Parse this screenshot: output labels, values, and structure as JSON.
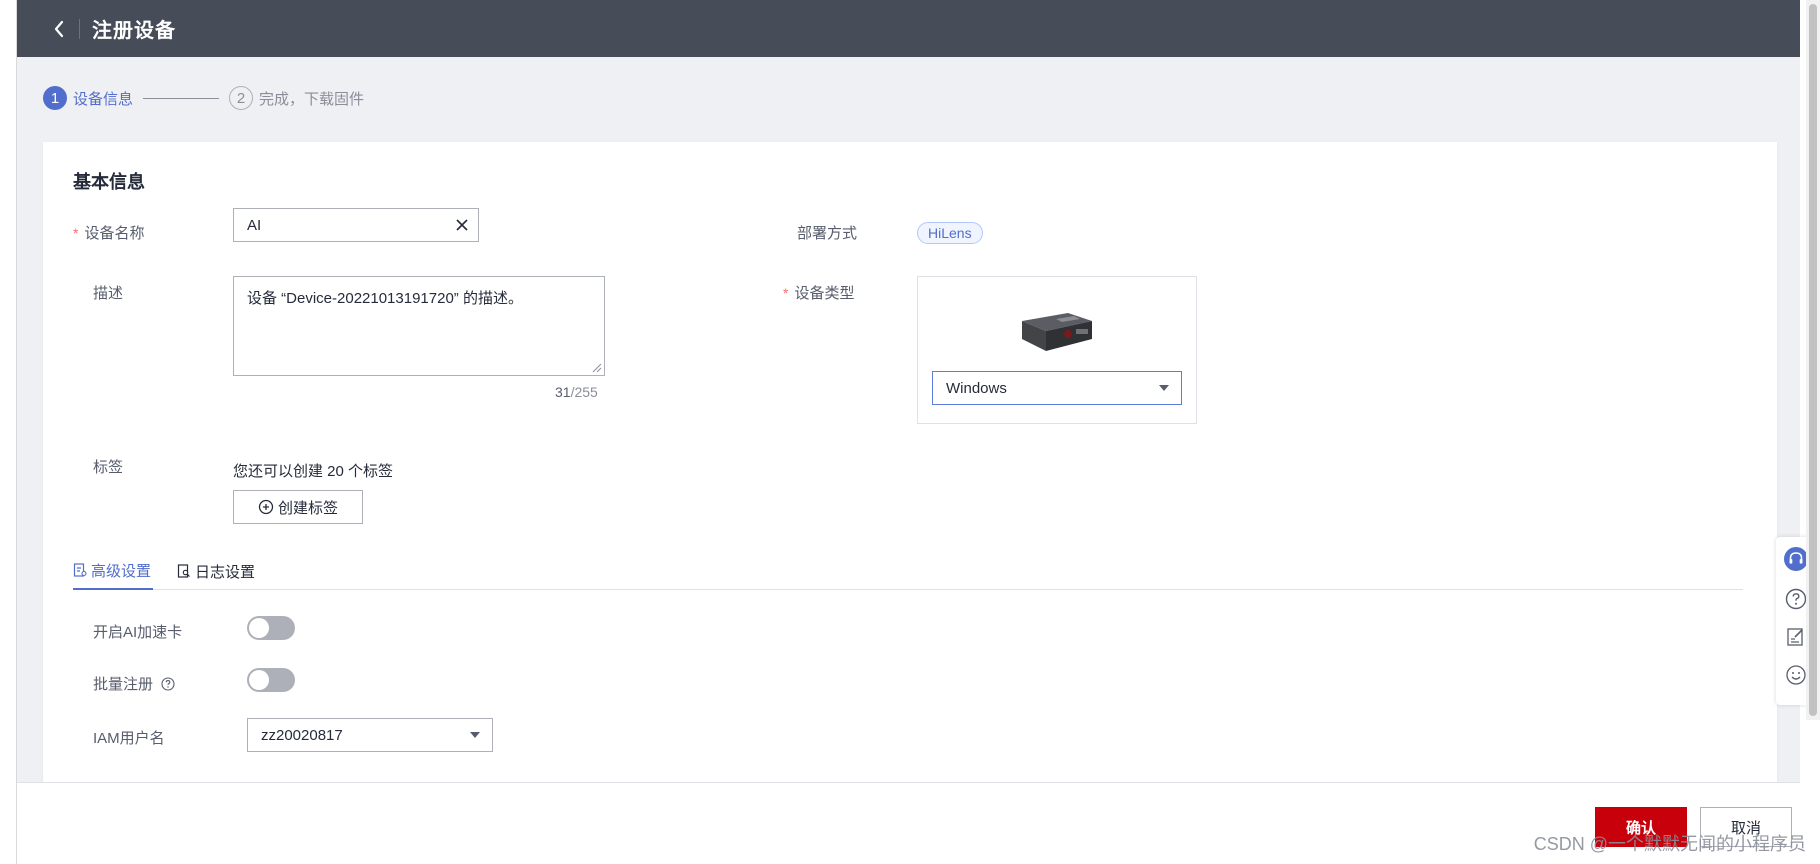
{
  "header": {
    "title": "注册设备"
  },
  "steps": [
    {
      "number": "1",
      "label": "设备信息"
    },
    {
      "number": "2",
      "label": "完成，下载固件"
    }
  ],
  "basic": {
    "section_title": "基本信息",
    "name_label": "设备名称",
    "name_value": "AI",
    "desc_label": "描述",
    "desc_value": "设备 “Device-20221013191720” 的描述。",
    "desc_count": "31",
    "desc_max": "/255",
    "deploy_label": "部署方式",
    "deploy_value": "HiLens",
    "type_label": "设备类型",
    "type_value": "Windows",
    "tag_label": "标签",
    "tag_hint": "您还可以创建 20 个标签",
    "tag_button": "创建标签"
  },
  "tabs": [
    {
      "label": "高级设置",
      "active": true
    },
    {
      "label": "日志设置",
      "active": false
    }
  ],
  "advanced": {
    "ai_card_label": "开启AI加速卡",
    "ai_card_on": false,
    "batch_label": "批量注册",
    "batch_on": false,
    "iam_label": "IAM用户名",
    "iam_value": "zz20020817"
  },
  "footer": {
    "confirm": "确认",
    "cancel": "取消"
  },
  "watermark": "CSDN @一个默默无闻的小程序员",
  "colors": {
    "accent": "#526ecc",
    "primary_button": "#c7000b",
    "header_bg": "#474c59"
  }
}
